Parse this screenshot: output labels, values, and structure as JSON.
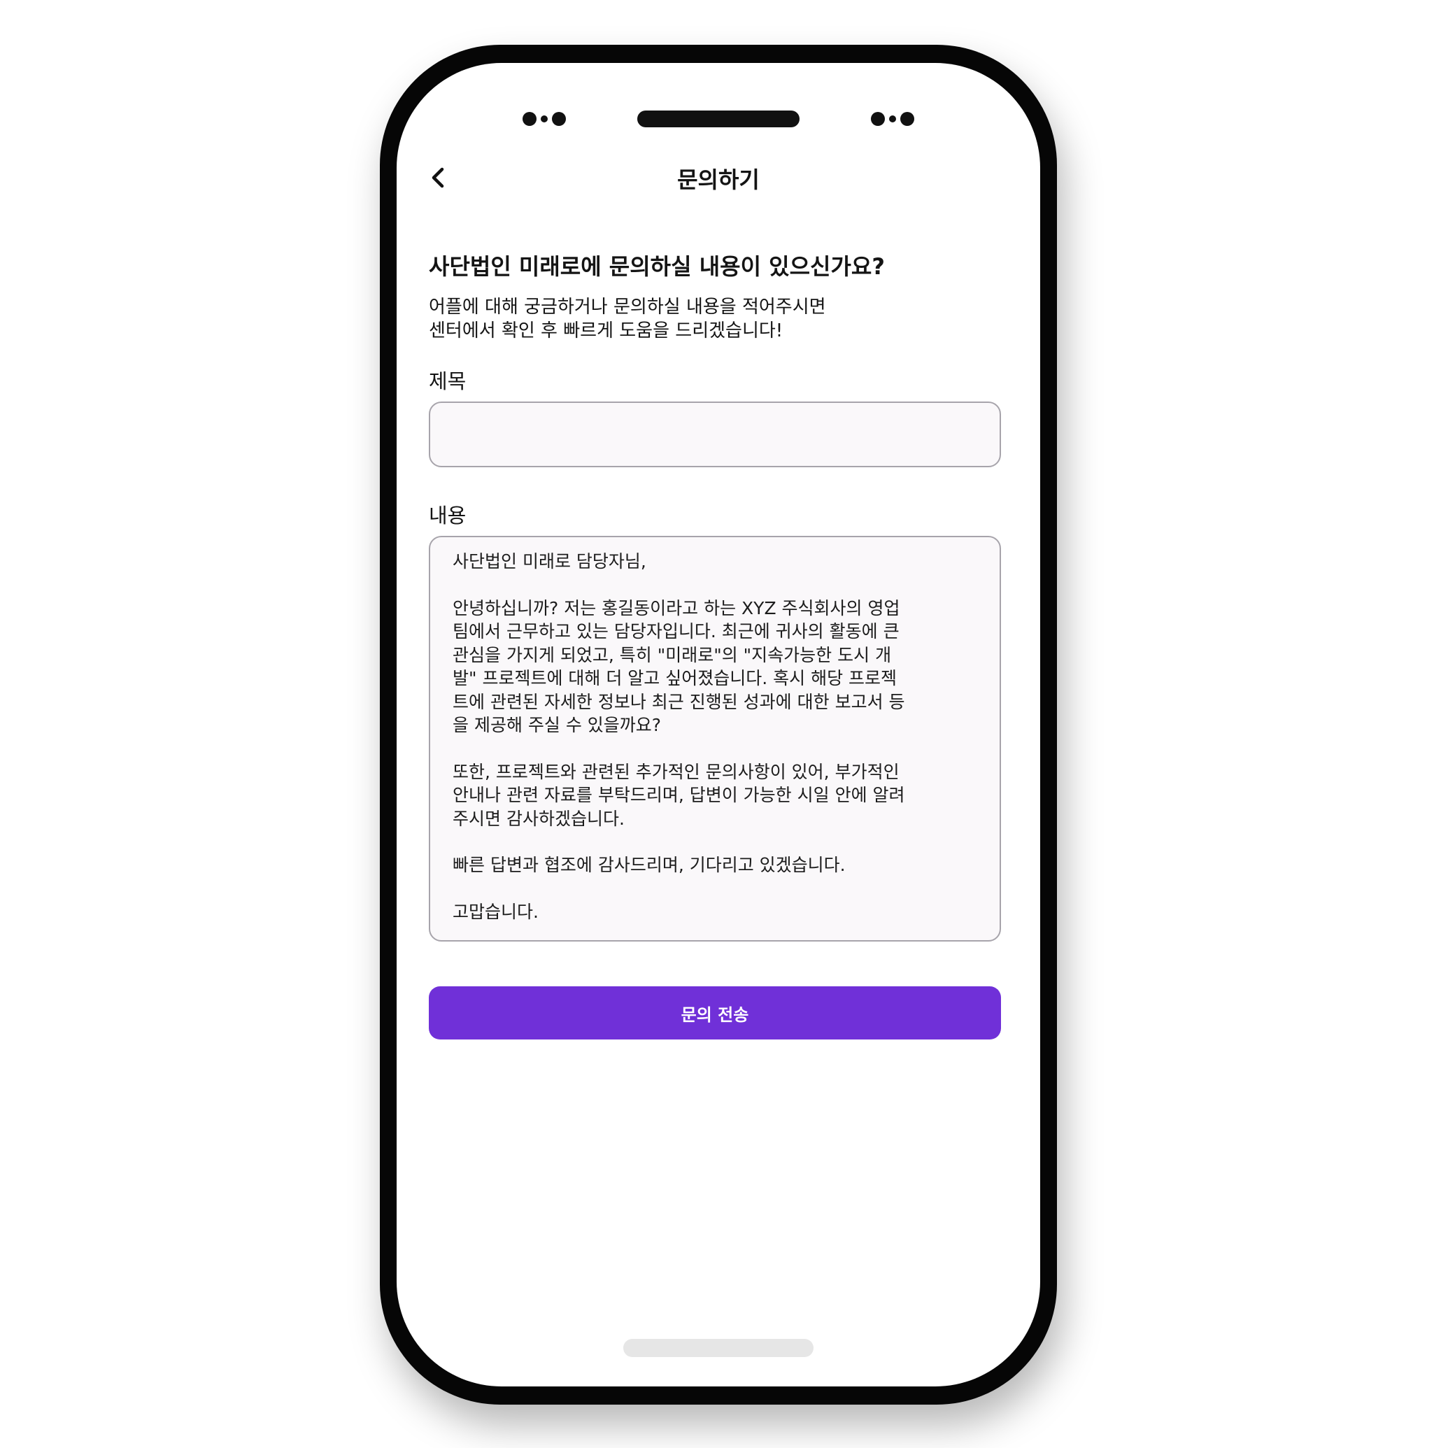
{
  "nav": {
    "title": "문의하기",
    "back_icon": "chevron-left-icon"
  },
  "intro": {
    "heading": "사단법인 미래로에 문의하실 내용이 있으신가요?",
    "description_line1": "어플에 대해 궁금하거나 문의하실 내용을 적어주시면",
    "description_line2": "센터에서 확인 후 빠르게 도움을 드리겠습니다!"
  },
  "form": {
    "title_label": "제목",
    "title_value": "",
    "content_label": "내용",
    "content_paragraphs": [
      "사단법인 미래로 담당자님,",
      "안녕하십니까? 저는 홍길동이라고 하는 XYZ 주식회사의 영업\n팀에서 근무하고 있는 담당자입니다. 최근에 귀사의 활동에 큰\n관심을 가지게 되었고, 특히 \"미래로\"의 \"지속가능한 도시 개\n발\" 프로젝트에 대해 더 알고 싶어졌습니다. 혹시 해당 프로젝\n트에 관련된 자세한 정보나 최근 진행된 성과에 대한 보고서 등\n을 제공해 주실 수 있을까요?",
      "또한, 프로젝트와 관련된 추가적인 문의사항이 있어, 부가적인\n안내나 관련 자료를 부탁드리며, 답변이 가능한 시일 안에 알려\n주시면 감사하겠습니다.",
      "빠른 답변과 협조에 감사드리며, 기다리고 있겠습니다.",
      "고맙습니다."
    ],
    "submit_label": "문의 전송"
  },
  "colors": {
    "accent": "#7030d8",
    "input_border": "#a7a4ab",
    "input_bg": "#faf8fa",
    "phone_frame": "#060606"
  }
}
